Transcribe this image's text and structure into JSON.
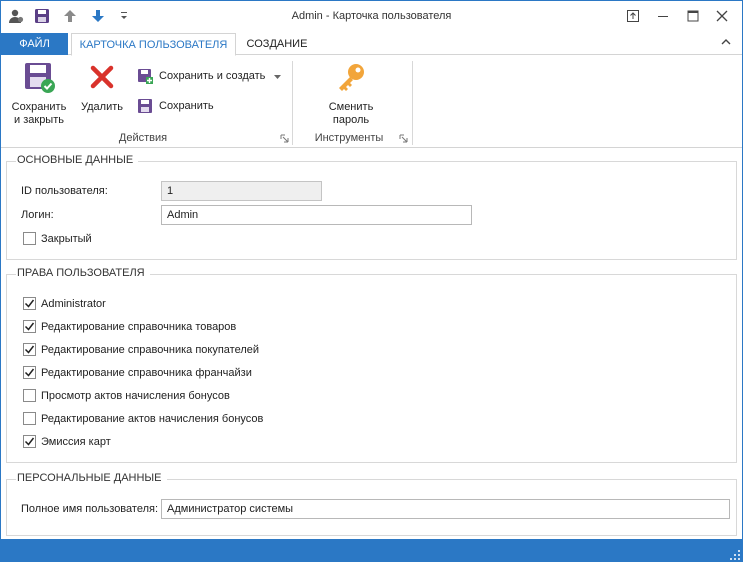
{
  "window": {
    "title": "Admin - Карточка пользователя"
  },
  "quick_access": {
    "icons": [
      "user-icon",
      "save-icon",
      "arrow-up-icon",
      "arrow-down-icon",
      "customize-dropdown-icon"
    ]
  },
  "tabs": {
    "file": "ФАЙЛ",
    "items": [
      {
        "label": "КАРТОЧКА ПОЛЬЗОВАТЕЛЯ",
        "active": true
      },
      {
        "label": "СОЗДАНИЕ",
        "active": false
      }
    ]
  },
  "ribbon": {
    "groups": {
      "actions": {
        "label": "Действия",
        "save_close": "Сохранить и закрыть",
        "save_close_line1": "Сохранить",
        "save_close_line2": "и закрыть",
        "delete": "Удалить",
        "save_create": "Сохранить и создать",
        "save": "Сохранить"
      },
      "tools": {
        "label": "Инструменты",
        "change_password_line1": "Сменить",
        "change_password_line2": "пароль"
      }
    }
  },
  "basic": {
    "title": "ОСНОВНЫЕ ДАННЫЕ",
    "id_label": "ID пользователя:",
    "id_value": "1",
    "login_label": "Логин:",
    "login_value": "Admin",
    "closed_label": "Закрытый",
    "closed_checked": false
  },
  "rights": {
    "title": "ПРАВА ПОЛЬЗОВАТЕЛЯ",
    "items": [
      {
        "label": "Administrator",
        "checked": true
      },
      {
        "label": "Редактирование справочника товаров",
        "checked": true
      },
      {
        "label": "Редактирование справочника покупателей",
        "checked": true
      },
      {
        "label": "Редактирование справочника франчайзи",
        "checked": true
      },
      {
        "label": "Просмотр актов начисления бонусов",
        "checked": false
      },
      {
        "label": "Редактирование актов начисления бонусов",
        "checked": false
      },
      {
        "label": "Эмиссия карт",
        "checked": true
      }
    ]
  },
  "personal": {
    "title": "ПЕРСОНАЛЬНЫЕ ДАННЫЕ",
    "fullname_label": "Полное имя пользователя:",
    "fullname_value": "Администратор системы"
  },
  "colors": {
    "accent": "#2b78c5",
    "delete_red": "#d9322b",
    "key_orange": "#f2a53a",
    "save_purple": "#6a4c93",
    "check_green": "#3aa655"
  }
}
